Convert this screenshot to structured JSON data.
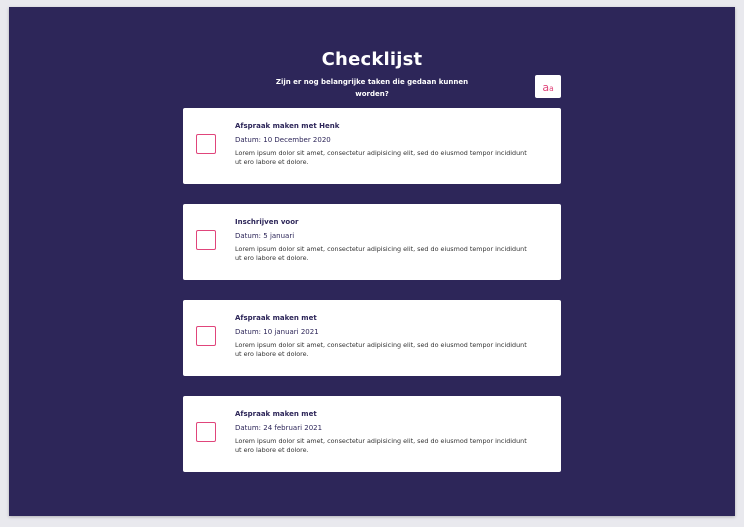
{
  "header": {
    "title": "Checklijst",
    "subtitle": "Zijn er nog belangrijke taken die gedaan kunnen worden?",
    "font_toggle": {
      "big": "a",
      "small": "a"
    }
  },
  "tasks": [
    {
      "title": "Afspraak maken met Henk",
      "date": "Datum: 10 December 2020",
      "description": "Lorem ipsum dolor sit amet, consectetur adipisicing elit, sed do eiusmod tempor incididunt ut ero labore et dolore.",
      "checked": false
    },
    {
      "title": "Inschrijven voor",
      "date": "Datum: 5 januari",
      "description": "Lorem ipsum dolor sit amet, consectetur adipisicing elit, sed do eiusmod tempor incididunt ut ero labore et dolore.",
      "checked": false
    },
    {
      "title": "Afspraak maken met",
      "date": "Datum: 10 januari 2021",
      "description": "Lorem ipsum dolor sit amet, consectetur adipisicing elit, sed do eiusmod tempor incididunt ut ero labore et dolore.",
      "checked": false
    },
    {
      "title": "Afspraak maken met",
      "date": "Datum: 24 februari 2021",
      "description": "Lorem ipsum dolor sit amet, consectetur adipisicing elit, sed do eiusmod tempor incididunt ut ero labore et dolore.",
      "checked": false
    }
  ],
  "colors": {
    "background": "#2d2659",
    "accent": "#e0457b",
    "card": "#ffffff",
    "text_primary": "#2d2659"
  }
}
